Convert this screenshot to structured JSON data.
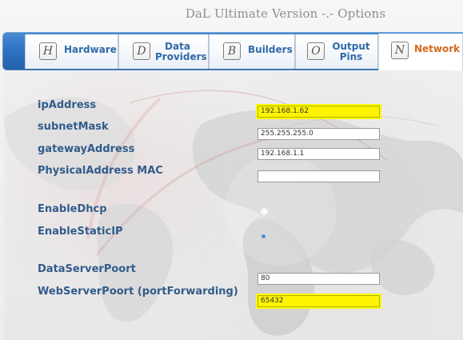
{
  "window": {
    "title": "DaL Ultimate Version -.- Options"
  },
  "tabs": [
    {
      "icon": "H",
      "label": "Hardware"
    },
    {
      "icon": "D",
      "label": "Data Providers",
      "line1": "Data",
      "line2": "Providers"
    },
    {
      "icon": "B",
      "label": "Builders"
    },
    {
      "icon": "O",
      "label": "Output Pins",
      "line1": "Output",
      "line2": "Pins"
    },
    {
      "icon": "N",
      "label": "Network"
    }
  ],
  "network": {
    "labels": {
      "ipAddress": "ipAddress",
      "subnetMask": "subnetMask",
      "gatewayAddress": "gatewayAddress",
      "physicalAddressMac": "PhysicalAddress MAC",
      "enableDhcp": "EnableDhcp",
      "enableStaticIp": "EnableStaticIP",
      "dataServerPort": "DataServerPoort",
      "webServerPort": "WebServerPoort (portForwarding)"
    },
    "values": {
      "ipAddress": "192.168.1.62",
      "subnetMask": "255.255.255.0",
      "gatewayAddress": "192.168.1.1",
      "physicalAddressMac": "",
      "dataServerPort": "80",
      "webServerPort": "65432"
    },
    "options": {
      "enableDhcp": false,
      "enableStaticIp": true
    }
  },
  "colors": {
    "tabbar": "#2f74c4",
    "tabLabel": "#2f6aa8",
    "activeTabLabel": "#d46a1b",
    "fieldLabel": "#315c8b",
    "highlight": "#fff400"
  }
}
